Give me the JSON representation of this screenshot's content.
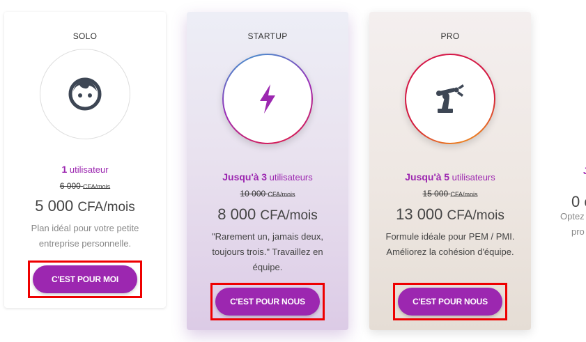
{
  "plans": [
    {
      "name": "SOLO",
      "icon": "user-face-icon",
      "users_prefix": "",
      "users_count": "1",
      "users_label": "utilisateur",
      "old_price": "6 000",
      "old_price_unit": "CFA/mois",
      "price": "5 000",
      "price_unit": "CFA/mois",
      "description": "Plan idéal pour votre petite entreprise personnelle.",
      "cta": "C'EST POUR MOI"
    },
    {
      "name": "STARTUP",
      "icon": "lightning-bolt-icon",
      "users_prefix": "Jusqu'à",
      "users_count": "3",
      "users_label": "utilisateurs",
      "old_price": "10 000",
      "old_price_unit": "CFA/mois",
      "price": "8 000",
      "price_unit": "CFA/mois",
      "description": "\"Rarement un, jamais deux, toujours trois.\" Travaillez en équipe.",
      "cta": "C'EST POUR NOUS"
    },
    {
      "name": "PRO",
      "icon": "robot-arm-icon",
      "users_prefix": "Jusqu'à",
      "users_count": "5",
      "users_label": "utilisateurs",
      "old_price": "15 000",
      "old_price_unit": "CFA/mois",
      "price": "13 000",
      "price_unit": "CFA/mois",
      "description": "Formule idéale pour PEM / PMI. Améliorez la cohésion d'équipe.",
      "cta": "C'EST POUR NOUS"
    }
  ],
  "next_card": {
    "users_fragment": "J",
    "price_fragment": "0 c",
    "desc_line1": "Optez",
    "desc_line2": "pro"
  },
  "colors": {
    "accent": "#9c27b0",
    "highlight_outline": "#ee0000"
  }
}
